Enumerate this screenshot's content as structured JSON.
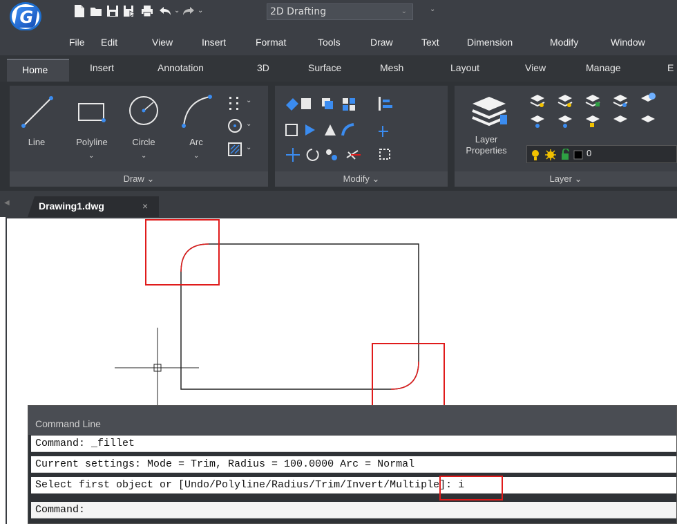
{
  "app": {
    "logo_letter": "G",
    "workspace": "2D Drafting",
    "quick_access_icons": [
      "new-file-icon",
      "open-folder-icon",
      "save-icon",
      "save-as-icon",
      "print-icon",
      "undo-icon",
      "redo-icon"
    ]
  },
  "menubar": {
    "items": [
      "File",
      "Edit",
      "View",
      "Insert",
      "Format",
      "Tools",
      "Draw",
      "Text",
      "Dimension",
      "Modify",
      "Window"
    ]
  },
  "ribbon_tabs": {
    "items": [
      "Home",
      "Insert",
      "Annotation",
      "3D",
      "Surface",
      "Mesh",
      "Layout",
      "View",
      "Manage",
      "E"
    ]
  },
  "ribbon": {
    "draw_panel": {
      "title": "Draw",
      "tools": [
        "Line",
        "Polyline",
        "Circle",
        "Arc"
      ]
    },
    "modify_panel": {
      "title": "Modify"
    },
    "layer_panel": {
      "title": "Layer",
      "layer_properties_line1": "Layer",
      "layer_properties_line2": "Properties",
      "current_layer": "0"
    }
  },
  "document": {
    "tab_name": "Drawing1.dwg",
    "close_glyph": "×"
  },
  "command_line": {
    "title": "Command Line",
    "lines": [
      "Command: _fillet",
      "Current settings: Mode = Trim, Radius = 100.0000 Arc = Normal",
      "Select first object or [Undo/Polyline/Radius/Trim/Invert/Multiple]: i"
    ],
    "prompt": "Command:"
  },
  "colors": {
    "highlight": "#e01b1b",
    "accent": "#1d6fd0"
  }
}
